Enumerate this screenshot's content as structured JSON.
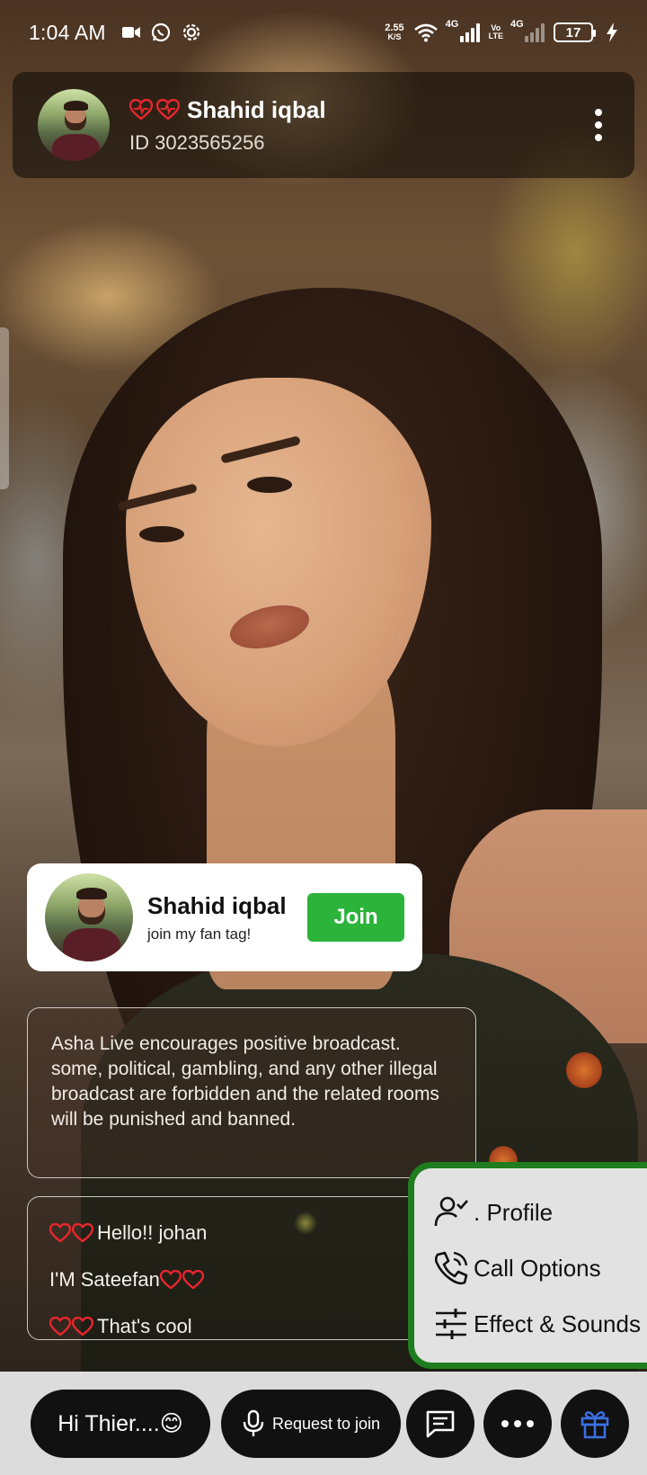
{
  "status_bar": {
    "time": "1:04 AM",
    "speed_value": "2.55",
    "speed_unit": "K/S",
    "network1": "4G",
    "volte_top": "Vo",
    "volte_bottom": "LTE",
    "network2": "4G",
    "battery": "17",
    "icons": [
      "video-camera-icon",
      "whatsapp-icon",
      "settings-gear-icon",
      "wifi-icon",
      "signal-icon",
      "battery-icon",
      "charging-bolt-icon"
    ]
  },
  "host": {
    "name": "Shahid iqbal",
    "id_text": "ID 3023565256",
    "badge_icons": [
      "heartbeat-heart-icon",
      "heartbeat-heart-icon"
    ]
  },
  "fan_tag": {
    "name": "Shahid iqbal",
    "subtitle": "join my fan tag!",
    "join_label": "Join",
    "join_color": "#2bb33a"
  },
  "notice": {
    "text": "Asha Live encourages positive broadcast. some, political, gambling, and any other illegal broadcast are forbidden and the related rooms will be punished and banned."
  },
  "chat": {
    "messages": [
      {
        "text": "Hello!! johan",
        "hearts_position": "before"
      },
      {
        "text": "I'M Sateefan",
        "hearts_position": "after"
      },
      {
        "text": "That's cool",
        "hearts_position": "before"
      }
    ],
    "heart_color": "#e8262c"
  },
  "action_menu": {
    "border_color": "#1e7d1e",
    "items": [
      {
        "label": ". Profile",
        "icon": "user-check-icon"
      },
      {
        "label": "Call Options",
        "icon": "phone-call-icon"
      },
      {
        "label": "Effect & Sounds",
        "icon": "sliders-icon"
      }
    ]
  },
  "bottom_bar": {
    "chat_input_value": "Hi Thier....😊",
    "request_join_label": "Request to join",
    "icons": [
      "microphone-icon",
      "message-icon",
      "more-dots-icon",
      "gift-icon"
    ],
    "gift_color": "#3b6fe0"
  }
}
